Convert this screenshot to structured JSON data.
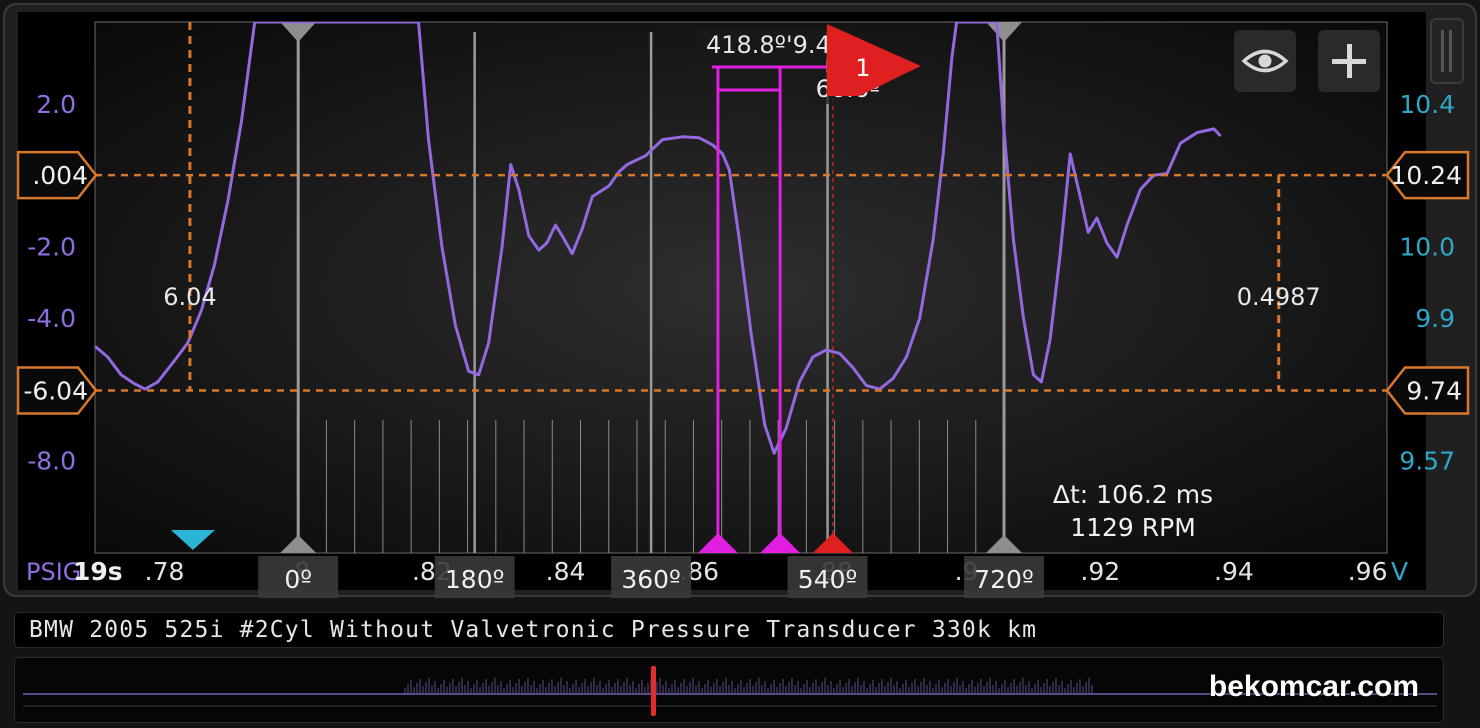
{
  "colors": {
    "trace": "#9468e0",
    "left_axis": "#8f6fe0",
    "right_axis": "#2fa6c8",
    "cursor": "#d7782a",
    "marker": "#e21fe0",
    "trigger": "#e02020",
    "tdc": "#9a9a9a",
    "trigger_level": "#2ab5d6"
  },
  "left_axis": {
    "unit": "PSIG",
    "ticks": [
      {
        "label": "2.0",
        "value": 2.0
      },
      {
        "label": "-2.0",
        "value": -2.0
      },
      {
        "label": "-4.0",
        "value": -4.0
      },
      {
        "label": "-8.0",
        "value": -8.0
      }
    ],
    "range": [
      -10.6,
      4.3
    ]
  },
  "right_axis": {
    "unit": "V",
    "ticks": [
      {
        "label": "10.4",
        "value": 10.4
      },
      {
        "label": "10.0",
        "value": 10.0
      },
      {
        "label": "9.9",
        "value": 9.9
      },
      {
        "label": "9.57",
        "value": 9.57
      }
    ]
  },
  "x_axis": {
    "range": [
      0.7696,
      0.9629
    ],
    "timebase": "19s",
    "ticks": [
      {
        "label": ".78",
        "value": 0.78
      },
      {
        "label": ".8",
        "value": 0.8
      },
      {
        "label": ".82",
        "value": 0.82
      },
      {
        "label": ".84",
        "value": 0.84
      },
      {
        "label": ".86",
        "value": 0.86
      },
      {
        "label": ".88",
        "value": 0.88
      },
      {
        "label": ".9",
        "value": 0.9
      },
      {
        "label": ".92",
        "value": 0.92
      },
      {
        "label": ".94",
        "value": 0.94
      },
      {
        "label": ".96",
        "value": 0.96
      }
    ]
  },
  "cursors": {
    "horizontal": [
      {
        "left_label": ".004",
        "right_label": "10.24",
        "value": 0.004
      },
      {
        "left_label": "-6.04",
        "right_label": "9.74",
        "value": -6.04
      }
    ],
    "vertical": [
      {
        "x": 0.7838,
        "readout": "6.04"
      },
      {
        "x": 0.9467,
        "readout": "0.4987"
      }
    ]
  },
  "tdc_markers": [
    {
      "label": "0º",
      "x": 0.8
    },
    {
      "label": "180º",
      "x": 0.8264
    },
    {
      "label": "360º",
      "x": 0.8528
    },
    {
      "label": "540º",
      "x": 0.8792
    },
    {
      "label": "720º",
      "x": 0.9056
    }
  ],
  "crank_ticks": {
    "start": 0.8,
    "end": 0.9056,
    "count": 25
  },
  "phase_markers": {
    "marker_a_x": 0.8628,
    "marker_b_x": 0.8721,
    "readout_total": "418.8º'9.4º",
    "readout_gap": "60.6º"
  },
  "trigger": {
    "label": "1",
    "x": 0.88,
    "level": 0.78
  },
  "timing": {
    "delta_t": "Δt: 106.2 ms",
    "rpm": "1129 RPM"
  },
  "waveform": [
    [
      0.7696,
      -4.8
    ],
    [
      0.7715,
      -5.1
    ],
    [
      0.7735,
      -5.6
    ],
    [
      0.7755,
      -5.85
    ],
    [
      0.7771,
      -6.0
    ],
    [
      0.779,
      -5.8
    ],
    [
      0.7815,
      -5.2
    ],
    [
      0.7835,
      -4.7
    ],
    [
      0.7855,
      -3.8
    ],
    [
      0.7875,
      -2.5
    ],
    [
      0.7895,
      -0.7
    ],
    [
      0.7915,
      1.5
    ],
    [
      0.7935,
      4.3
    ],
    [
      0.818,
      4.3
    ],
    [
      0.8195,
      1.0
    ],
    [
      0.8215,
      -2.0
    ],
    [
      0.8235,
      -4.2
    ],
    [
      0.8255,
      -5.5
    ],
    [
      0.827,
      -5.6
    ],
    [
      0.8285,
      -4.7
    ],
    [
      0.8305,
      -2.0
    ],
    [
      0.8318,
      0.3
    ],
    [
      0.833,
      -0.4
    ],
    [
      0.8345,
      -1.7
    ],
    [
      0.836,
      -2.1
    ],
    [
      0.8372,
      -1.9
    ],
    [
      0.8385,
      -1.4
    ],
    [
      0.8395,
      -1.7
    ],
    [
      0.841,
      -2.2
    ],
    [
      0.8425,
      -1.5
    ],
    [
      0.844,
      -0.6
    ],
    [
      0.8465,
      -0.3
    ],
    [
      0.848,
      0.1
    ],
    [
      0.8492,
      0.3
    ],
    [
      0.852,
      0.55
    ],
    [
      0.8545,
      1.0
    ],
    [
      0.8575,
      1.08
    ],
    [
      0.86,
      1.05
    ],
    [
      0.862,
      0.85
    ],
    [
      0.8635,
      0.6
    ],
    [
      0.8645,
      0.15
    ],
    [
      0.866,
      -1.8
    ],
    [
      0.8678,
      -4.5
    ],
    [
      0.8698,
      -7.0
    ],
    [
      0.8712,
      -7.8
    ],
    [
      0.873,
      -7.1
    ],
    [
      0.875,
      -5.8
    ],
    [
      0.877,
      -5.1
    ],
    [
      0.879,
      -4.9
    ],
    [
      0.881,
      -5.0
    ],
    [
      0.883,
      -5.4
    ],
    [
      0.885,
      -5.9
    ],
    [
      0.887,
      -6.0
    ],
    [
      0.889,
      -5.7
    ],
    [
      0.891,
      -5.1
    ],
    [
      0.893,
      -4.0
    ],
    [
      0.895,
      -1.8
    ],
    [
      0.8965,
      0.6
    ],
    [
      0.8978,
      3.3
    ],
    [
      0.8985,
      4.3
    ],
    [
      0.9045,
      4.3
    ],
    [
      0.9055,
      1.5
    ],
    [
      0.907,
      -1.8
    ],
    [
      0.9085,
      -4.0
    ],
    [
      0.91,
      -5.6
    ],
    [
      0.9112,
      -5.8
    ],
    [
      0.9125,
      -4.6
    ],
    [
      0.914,
      -2.2
    ],
    [
      0.9155,
      0.6
    ],
    [
      0.917,
      -0.6
    ],
    [
      0.9182,
      -1.6
    ],
    [
      0.9195,
      -1.2
    ],
    [
      0.921,
      -1.9
    ],
    [
      0.9225,
      -2.3
    ],
    [
      0.924,
      -1.4
    ],
    [
      0.926,
      -0.4
    ],
    [
      0.928,
      0.0
    ],
    [
      0.93,
      0.05
    ],
    [
      0.932,
      0.9
    ],
    [
      0.9345,
      1.2
    ],
    [
      0.937,
      1.3
    ],
    [
      0.938,
      1.1
    ]
  ]
}
